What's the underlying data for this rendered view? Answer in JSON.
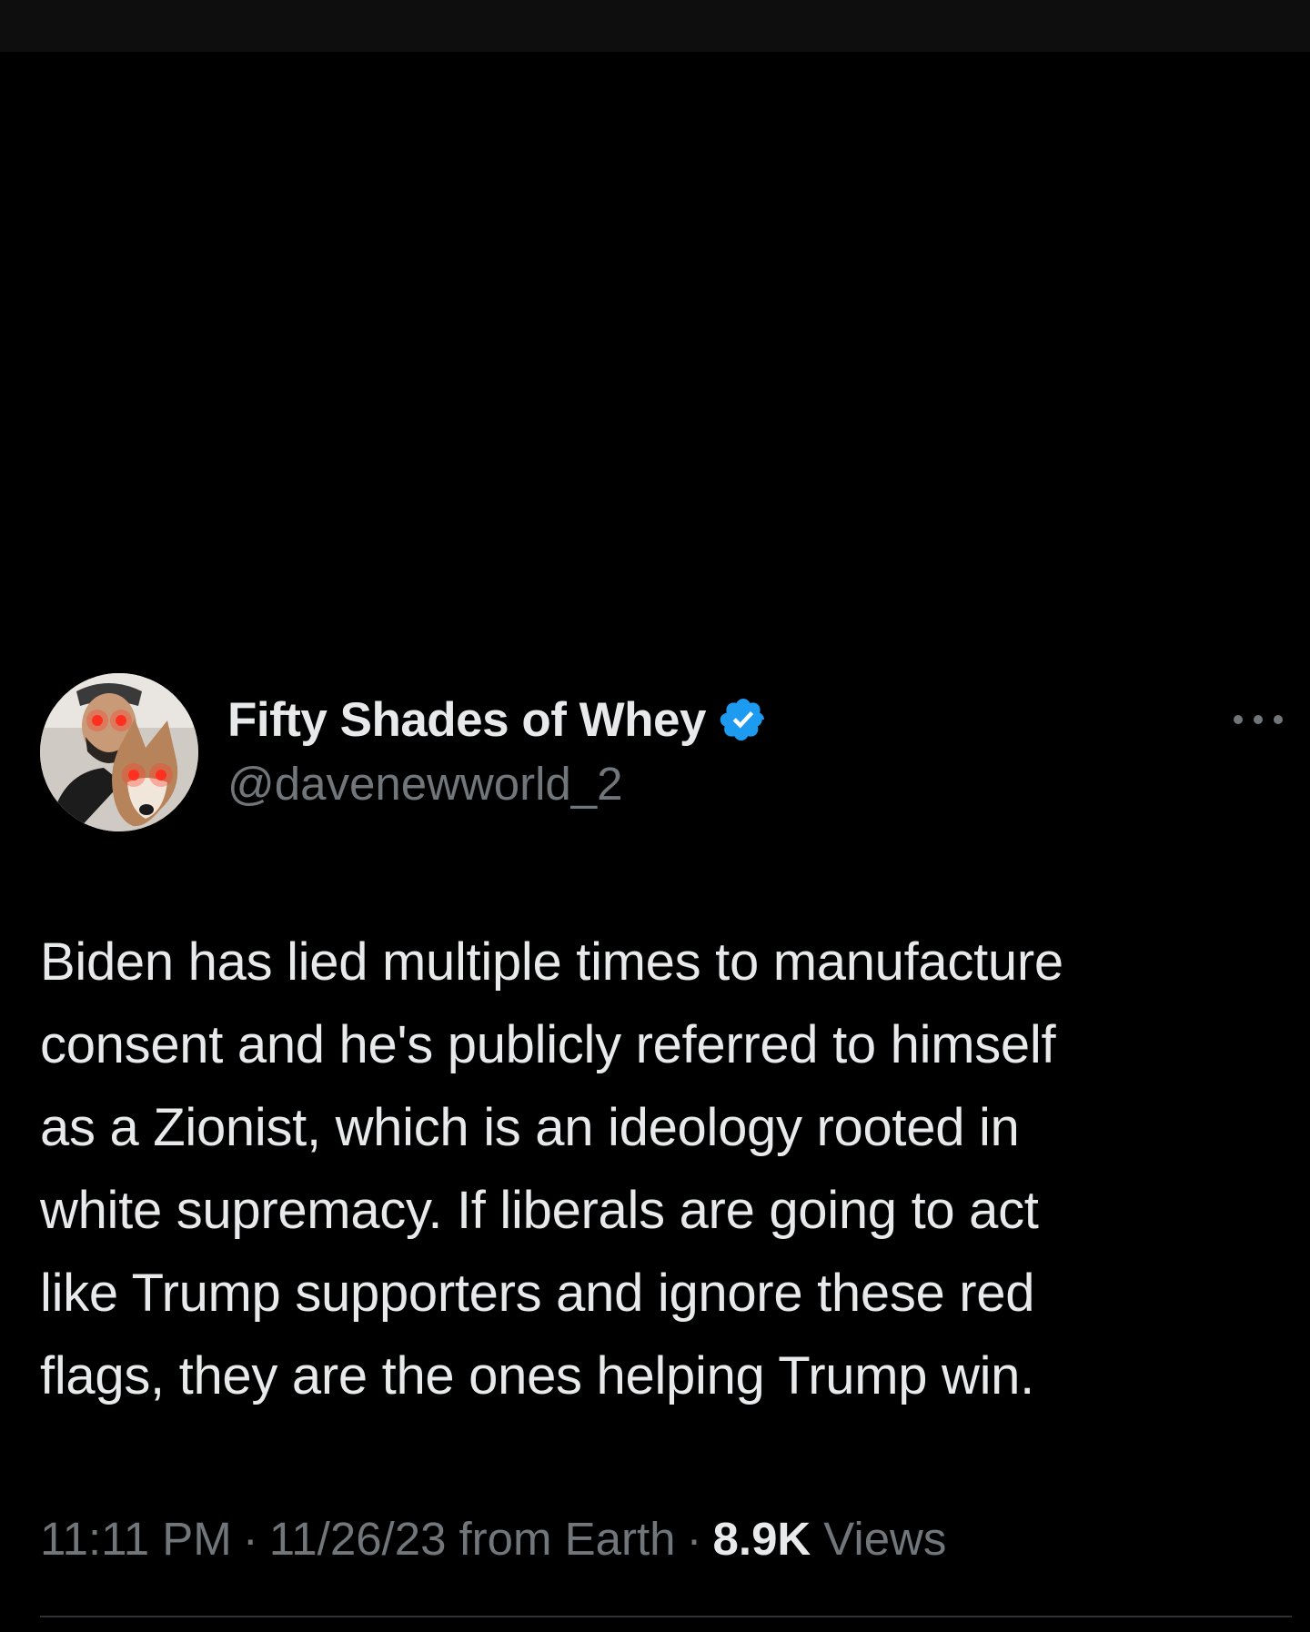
{
  "tweet": {
    "display_name": "Fifty Shades of Whey",
    "handle": "@davenewworld_2",
    "verified": true,
    "text": "Biden has lied multiple times to manufacture\nconsent and he's publicly referred to himself\nas a Zionist, which is an ideology rooted in\nwhite supremacy. If liberals are going to act\nlike Trump supporters and ignore these red\nflags, they are the ones helping Trump win.",
    "time": "11:11 PM",
    "date": "11/26/23",
    "source": "from Earth",
    "separator": "·",
    "views_count": "8.9K",
    "views_label": "Views"
  },
  "colors": {
    "background": "#000000",
    "text_primary": "#e7e9ea",
    "text_secondary": "#71767b",
    "verified_blue": "#1d9bf0",
    "divider": "#2f3336"
  },
  "icons": {
    "verified": "verified-badge-icon",
    "more": "more-horizontal-icon"
  }
}
